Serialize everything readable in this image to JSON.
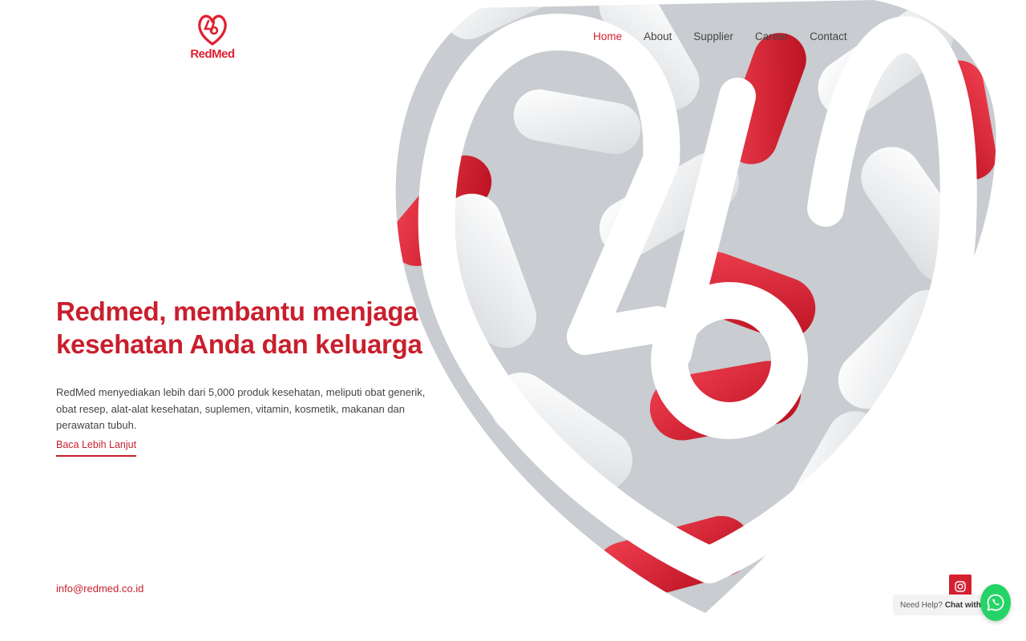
{
  "brand": {
    "name": "RedMed",
    "color": "#e0202f"
  },
  "nav": {
    "items": [
      {
        "label": "Home",
        "active": true
      },
      {
        "label": "About",
        "active": false
      },
      {
        "label": "Supplier",
        "active": false
      },
      {
        "label": "Career",
        "active": false
      },
      {
        "label": "Contact",
        "active": false
      }
    ]
  },
  "hero": {
    "title": "Redmed, membantu menjaga kesehatan Anda dan keluarga",
    "description": "RedMed menyediakan lebih dari 5,000 produk kesehatan, meliputi obat generik, obat resep, alat-alat kesehatan, suplemen, vitamin, kosmetik, makanan dan perawatan tubuh.",
    "cta_label": "Baca Lebih Lanjut",
    "image_icon": "capsule-heart-image"
  },
  "footer": {
    "email": "info@redmed.co.id"
  },
  "social": {
    "instagram_icon": "instagram-icon"
  },
  "chat": {
    "prefix": "Need Help?",
    "label": "Chat with us",
    "icon": "whatsapp-icon",
    "color": "#25d366"
  },
  "colors": {
    "accent": "#c91f2d",
    "text": "#444444"
  }
}
